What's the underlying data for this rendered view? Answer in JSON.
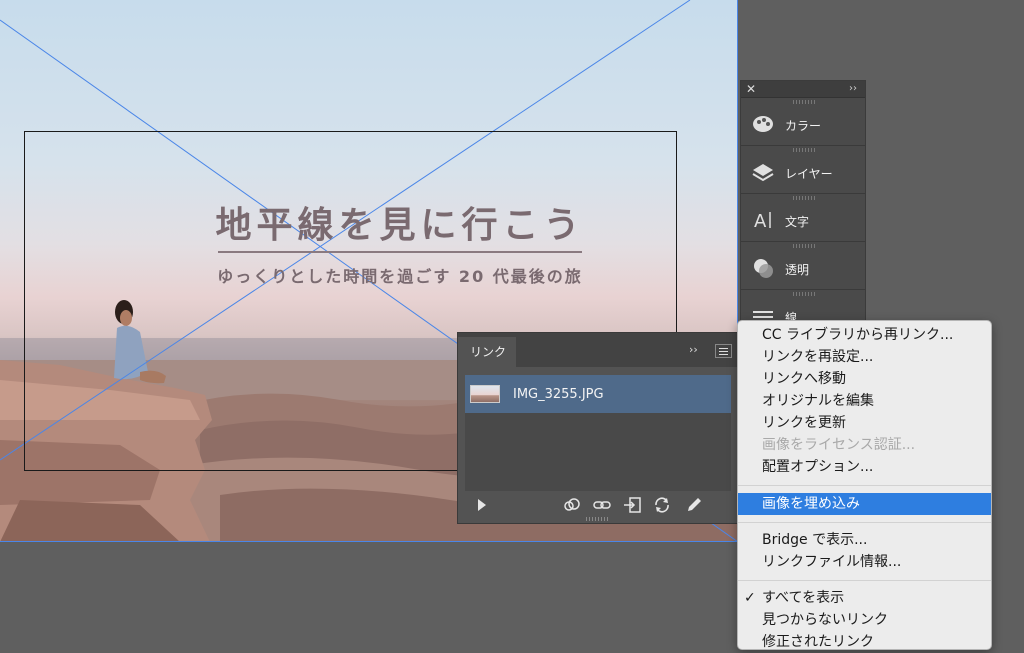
{
  "canvas": {
    "headline": "地平線を見に行こう",
    "subline": "ゆっくりとした時間を過ごす 20 代最後の旅"
  },
  "dock": {
    "items": [
      {
        "label": "カラー",
        "icon": "palette-icon"
      },
      {
        "label": "レイヤー",
        "icon": "layers-icon"
      },
      {
        "label": "文字",
        "icon": "character-icon"
      },
      {
        "label": "透明",
        "icon": "transparency-icon"
      },
      {
        "label": "線",
        "icon": "stroke-icon"
      }
    ]
  },
  "links_panel": {
    "tab": "リンク",
    "file": "IMG_3255.JPG",
    "toolbar_icons": [
      "play-icon",
      "cc-library-icon",
      "relink-icon",
      "goto-link-icon",
      "update-link-icon",
      "edit-original-icon"
    ]
  },
  "context_menu": {
    "items": [
      {
        "label": "CC ライブラリから再リンク...",
        "disabled": false
      },
      {
        "label": "リンクを再設定...",
        "disabled": false
      },
      {
        "label": "リンクへ移動",
        "disabled": false
      },
      {
        "label": "オリジナルを編集",
        "disabled": false
      },
      {
        "label": "リンクを更新",
        "disabled": false
      },
      {
        "label": "画像をライセンス認証...",
        "disabled": true
      },
      {
        "label": "配置オプション...",
        "disabled": false
      },
      {
        "label": "画像を埋め込み",
        "highlighted": true
      },
      {
        "label": "Bridge で表示...",
        "disabled": false
      },
      {
        "label": "リンクファイル情報...",
        "disabled": false
      },
      {
        "label": "すべてを表示",
        "checked": true
      },
      {
        "label": "見つからないリンク",
        "disabled": false
      },
      {
        "label": "修正されたリンク",
        "disabled": false
      }
    ]
  },
  "colors": {
    "accent": "#2e7ee0",
    "selection_row": "#4f6a8a",
    "guide_lines": "#4a86e8"
  }
}
